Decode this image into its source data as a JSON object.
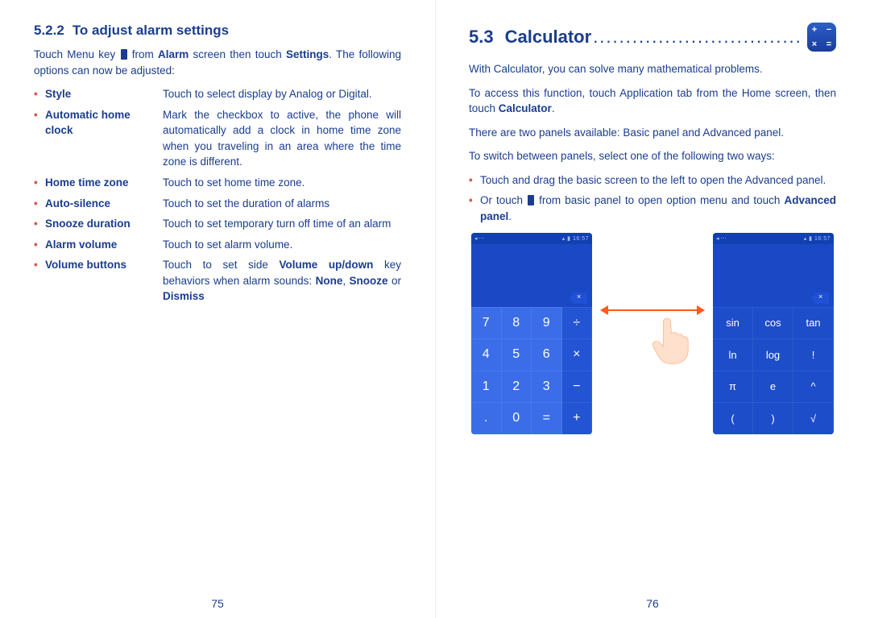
{
  "left": {
    "heading_num": "5.2.2",
    "heading_title": "To adjust alarm settings",
    "intro_a": "Touch Menu key ",
    "intro_b": " from ",
    "intro_c": "Alarm",
    "intro_d": " screen then touch ",
    "intro_e": "Settings",
    "intro_f": ". The following options can now be adjusted:",
    "options": [
      {
        "label": "Style",
        "desc_a": "Touch to select display by Analog or Digital."
      },
      {
        "label": "Automatic home clock",
        "desc_a": "Mark the checkbox to active, the phone will automatically add a clock in home time zone when you traveling in an area where the time zone is different."
      },
      {
        "label": "Home time zone",
        "desc_a": "Touch to set home time zone."
      },
      {
        "label": "Auto-silence",
        "desc_a": "Touch to set the duration of alarms"
      },
      {
        "label": "Snooze duration",
        "desc_a": "Touch to set temporary turn off time of an alarm"
      },
      {
        "label": "Alarm volume",
        "desc_a": "Touch to set alarm volume."
      },
      {
        "label": "Volume buttons",
        "desc_a": "Touch to set side ",
        "desc_b": "Volume up/down",
        "desc_c": " key behaviors when alarm sounds: ",
        "desc_d": "None",
        "desc_e": ", ",
        "desc_f": "Snooze",
        "desc_g": " or ",
        "desc_h": "Dismiss"
      }
    ],
    "page_num": "75"
  },
  "right": {
    "heading_num": "5.3",
    "heading_title": "Calculator",
    "p1": "With Calculator, you can solve many mathematical problems.",
    "p2a": "To access this function, touch Application tab from the Home screen, then touch ",
    "p2b": "Calculator",
    "p2c": ".",
    "p3": "There are two panels available: Basic panel and Advanced panel.",
    "p4": "To switch between panels, select one of the following two ways:",
    "b1": "Touch and drag the basic screen to the left to open the Advanced panel.",
    "b2a": "Or touch ",
    "b2b": " from basic panel to open option menu and touch ",
    "b2c": "Advanced panel",
    "b2d": ".",
    "status_time": "16:57",
    "basic_keys": [
      "7",
      "8",
      "9",
      "÷",
      "4",
      "5",
      "6",
      "×",
      "1",
      "2",
      "3",
      "−",
      ".",
      "0",
      "=",
      "+"
    ],
    "adv_keys": [
      "sin",
      "cos",
      "tan",
      "ln",
      "log",
      "!",
      "π",
      "e",
      "^",
      "(",
      ")",
      "√"
    ],
    "page_num": "76"
  }
}
